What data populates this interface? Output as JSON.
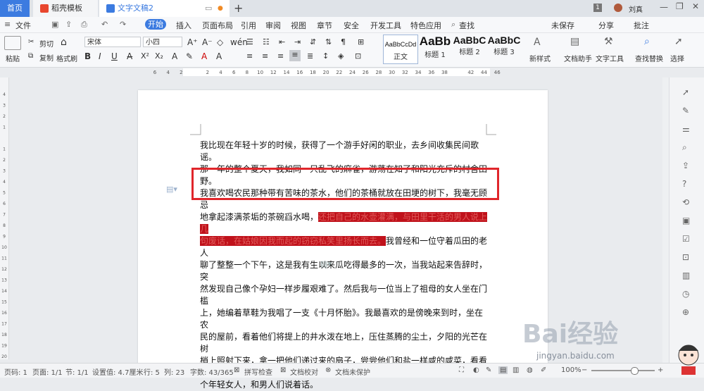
{
  "tabs": {
    "home": "首页",
    "template": "稻壳模板",
    "document": "文字文稿2"
  },
  "window": {
    "page_count": "1",
    "user": "刘真"
  },
  "menu": {
    "file": "文件",
    "start": "开始",
    "items": [
      "插入",
      "页面布局",
      "引用",
      "审阅",
      "视图",
      "章节",
      "安全",
      "开发工具",
      "特色应用"
    ],
    "search": "查找",
    "unsaved": "未保存",
    "share": "分享",
    "annotate": "批注"
  },
  "ribbon": {
    "paste": "粘贴",
    "cut": "剪切",
    "copy": "复制",
    "format_painter": "格式刷",
    "font_name": "宋体",
    "font_size": "小四",
    "styles": [
      {
        "preview": "AaBbCcDd",
        "name": "正文"
      },
      {
        "preview": "AaBb",
        "name": "标题 1"
      },
      {
        "preview": "AaBbC",
        "name": "标题 2"
      },
      {
        "preview": "AaBbC",
        "name": "标题 3"
      }
    ],
    "new_style": "新样式",
    "doc_assistant": "文档助手",
    "text_tools": "文字工具",
    "find_replace": "查找替换",
    "select": "选择"
  },
  "ruler": {
    "top_ticks": [
      "6",
      "4",
      "2",
      "",
      "2",
      "4",
      "6",
      "8",
      "10",
      "12",
      "14",
      "16",
      "18",
      "20",
      "22",
      "24",
      "26",
      "28",
      "30",
      "32",
      "34",
      "36",
      "38",
      "",
      "42",
      "44",
      "46"
    ],
    "side_ticks": [
      "4",
      "3",
      "2",
      "1",
      "",
      "1",
      "2",
      "3",
      "4",
      "5",
      "6",
      "7",
      "8",
      "9",
      "10",
      "11",
      "12",
      "13",
      "14",
      "15",
      "16",
      "17",
      "18",
      "19",
      "20"
    ]
  },
  "document": {
    "line1": "我比现在年轻十岁的时候，获得了一个游手好闲的职业，去乡间收集民间歌谣。",
    "line2": "那一年的整个夏天，我如同一只乱飞的麻雀，游荡在知了和阳光充斥的村舍田野。",
    "line3": "我喜欢喝农民那种带有苦味的茶水，他们的茶桶就放在田埂的树下，我毫无顾忌",
    "line4_plain": "地拿起漆满茶垢的茶碗舀水喝，",
    "line4_hl": "还把自己的水壶灌满，与田里干活的男人说上几",
    "line5_hl": "句废话，在姑娘因我而起的窃窃私笑里扬长而去。",
    "line5_plain": "我曾经和一位守着瓜田的老人",
    "line6": "聊了整整一个下午，这是我有生以来瓜吃得最多的一次，当我站起来告辞时，突",
    "line7": "然发现自己像个孕妇一样步履艰难了。然后我与一位当上了祖母的女人坐在门槛",
    "line8": "上，她编着草鞋为我唱了一支《十月怀胎》。我最喜欢的是傍晚来到时，坐在农",
    "line9": "民的屋前，看着他们将提上的井水泼在地上，压住蒸腾的尘土，夕阳的光芒在树",
    "line10": "梢上照射下来，拿一把他们递过来的扇子，尝尝他们和盐一样咸的咸菜，看看几",
    "line11": "个年轻女人，和男人们说着话。"
  },
  "status": {
    "page": "页码: 1",
    "pages": "页面: 1/1",
    "section": "节: 1/1",
    "setting": "设置值: 4.7厘米",
    "row": "行: 5",
    "col": "列: 23",
    "words": "字数: 43/365",
    "spell": "拼写检查",
    "proof": "文档校对",
    "protect": "文档未保护",
    "zoom": "100%"
  },
  "watermark": {
    "brand": "Bai经验",
    "url": "jingyan.baidu.com"
  },
  "colors": {
    "accent": "#3c7be0",
    "highlight": "#c0121b",
    "box": "#e0262b"
  }
}
